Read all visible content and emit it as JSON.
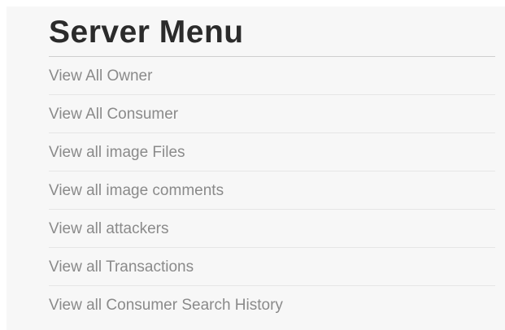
{
  "menu": {
    "title": "Server Menu",
    "items": [
      {
        "label": "View All Owner"
      },
      {
        "label": "View All Consumer"
      },
      {
        "label": "View all image Files"
      },
      {
        "label": "View all image comments"
      },
      {
        "label": "View all attackers"
      },
      {
        "label": "View all Transactions"
      },
      {
        "label": "View all Consumer Search History"
      }
    ]
  },
  "colors": {
    "background": "#f7f7f7",
    "title": "#2b2b2b",
    "link": "#8a8a8a",
    "divider": "#e6e6e6"
  }
}
